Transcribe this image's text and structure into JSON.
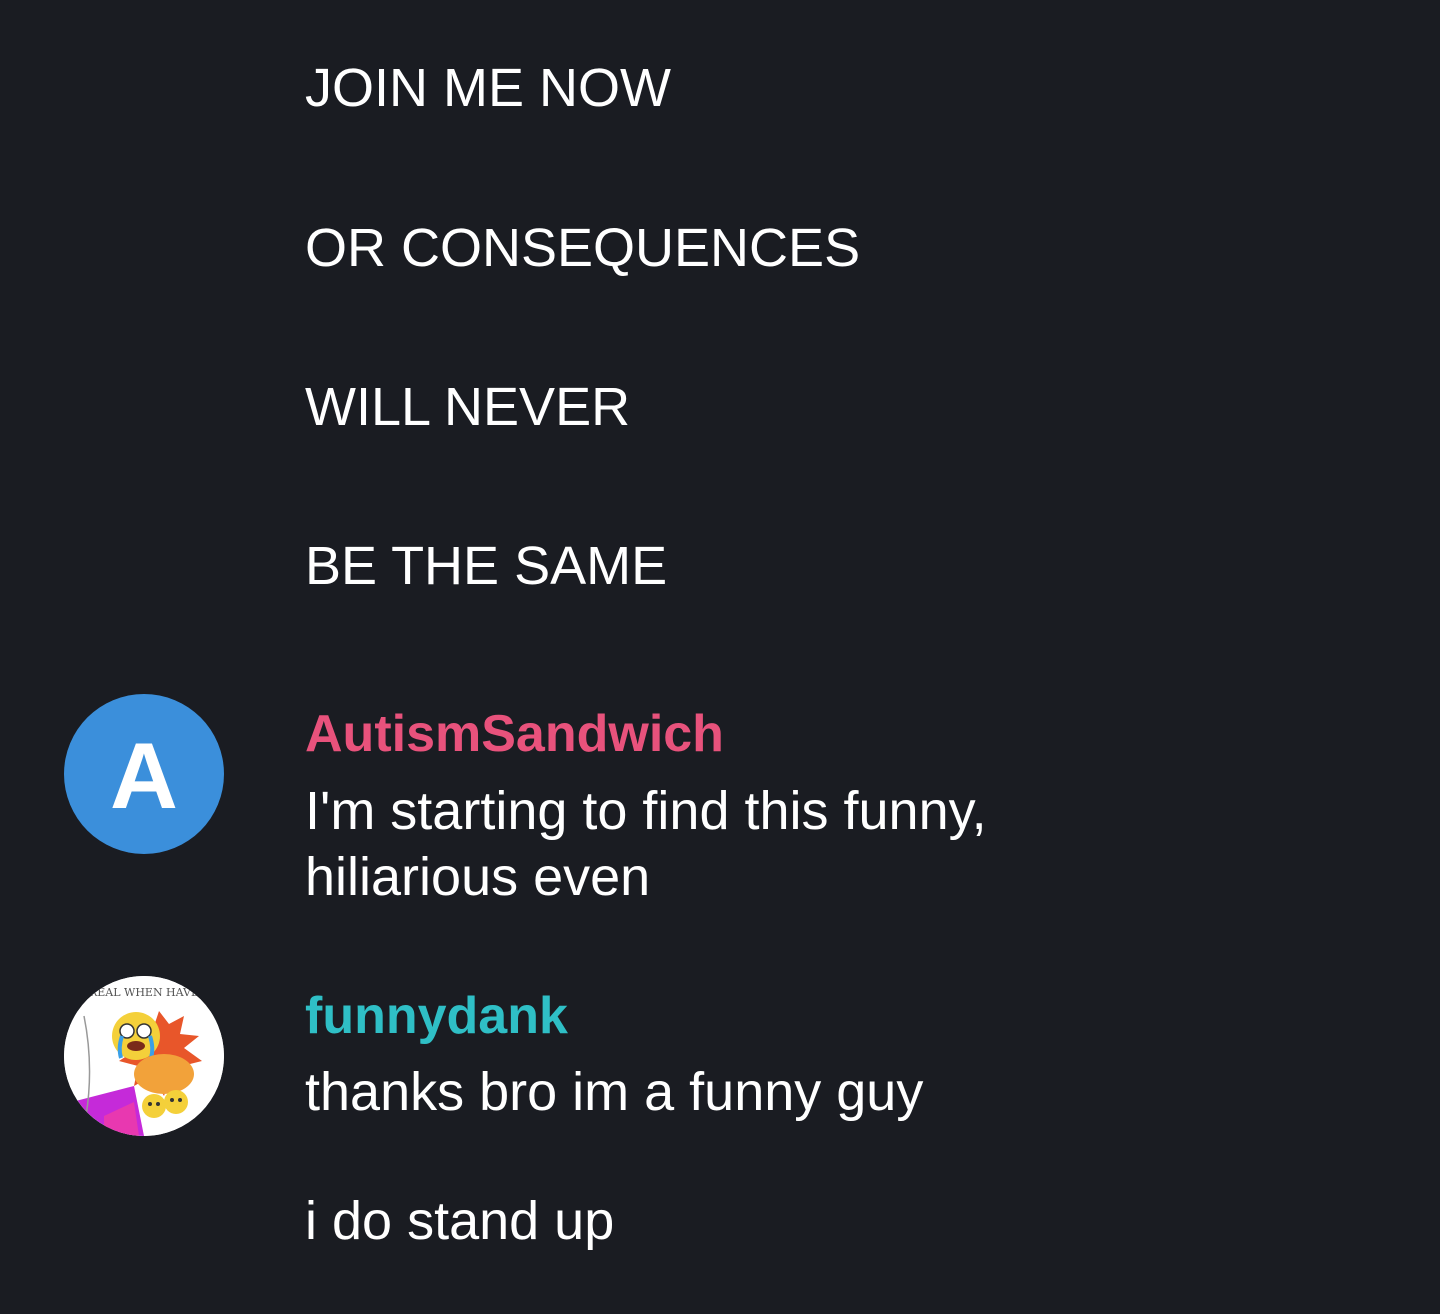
{
  "colors": {
    "background": "#1a1c22",
    "text": "#ffffff",
    "username_autismsandwich": "#e8527c",
    "username_funnydank": "#2fbfc6",
    "avatar_a_bg": "#3b8fdb"
  },
  "previous_message": {
    "lines": [
      "JOIN ME NOW",
      "OR CONSEQUENCES",
      "WILL NEVER",
      "BE THE SAME"
    ]
  },
  "messages": [
    {
      "username": "AutismSandwich",
      "avatar_letter": "A",
      "lines": [
        "I'm starting to find this funny,",
        "hiliarious even"
      ]
    },
    {
      "username": "funnydank",
      "avatar_icon": "meme-avatar-image",
      "avatar_caption": "REAL WHEN HAVE",
      "lines": [
        "thanks bro im a funny guy",
        "i do stand up"
      ]
    }
  ]
}
